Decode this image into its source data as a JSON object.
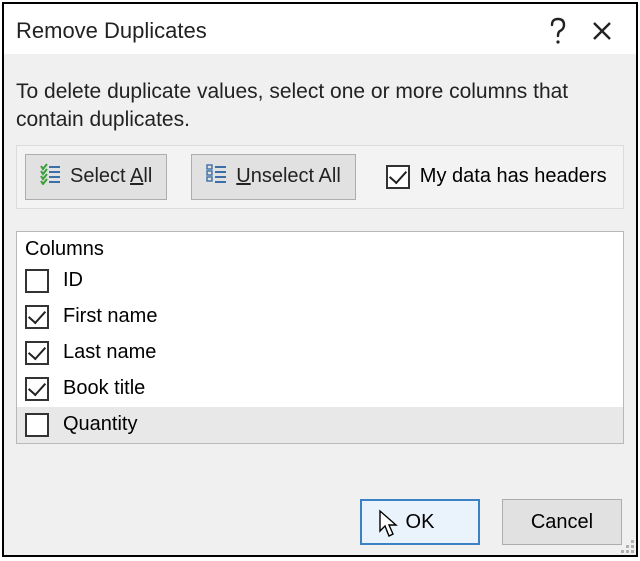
{
  "title": "Remove Duplicates",
  "instruction": "To delete duplicate values, select one or more columns that contain duplicates.",
  "buttons": {
    "select_all_prefix": "Select ",
    "select_all_u": "A",
    "select_all_suffix": "ll",
    "unselect_all_u": "U",
    "unselect_all_suffix": "nselect All",
    "headers_u": "M",
    "headers_suffix": "y data has headers",
    "ok": "OK",
    "cancel": "Cancel"
  },
  "columns_header": "Columns",
  "columns": [
    {
      "label": "ID",
      "checked": false
    },
    {
      "label": "First name",
      "checked": true
    },
    {
      "label": "Last name",
      "checked": true
    },
    {
      "label": "Book title",
      "checked": true
    },
    {
      "label": "Quantity",
      "checked": false
    }
  ],
  "headers_checked": true,
  "selected_row_index": 4
}
